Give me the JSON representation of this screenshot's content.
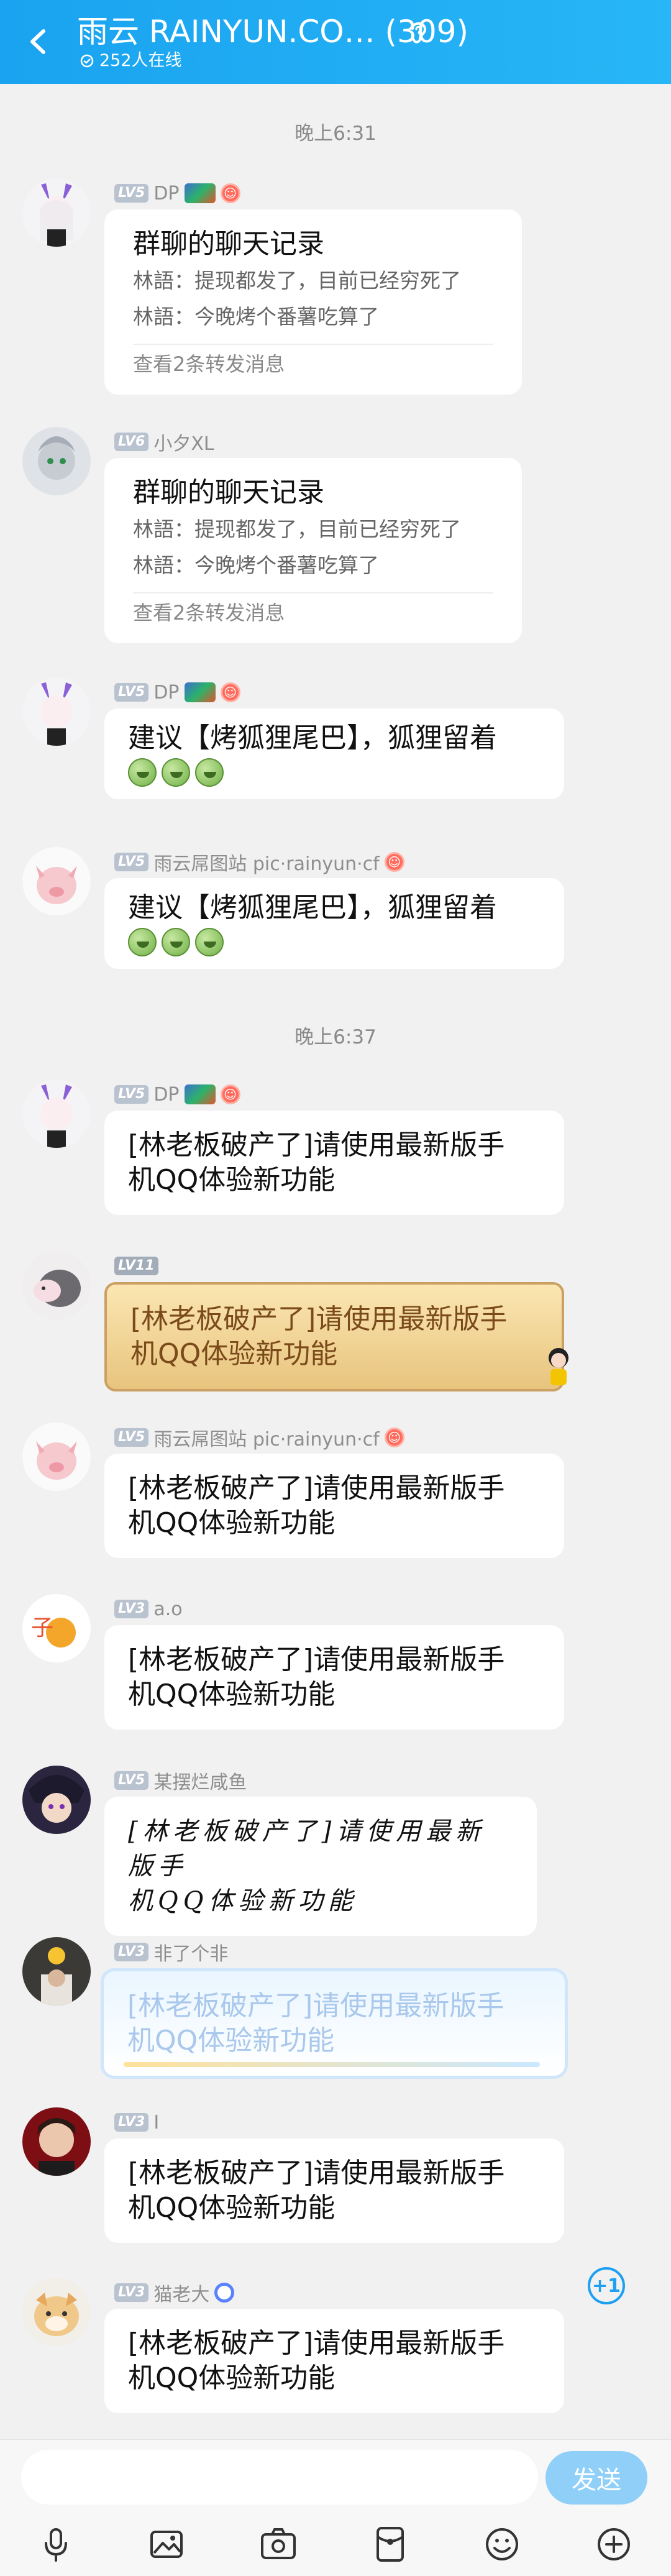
{
  "header": {
    "title": "雨云 RAINYUN.CO… (309)",
    "online": "252人在线"
  },
  "feed": {
    "time1": "晚上6:31",
    "time2": "晚上6:37",
    "messages": [
      {
        "level": "LV5",
        "name": "DP",
        "type": "forward",
        "title": "群聊的聊天记录",
        "lines": [
          "林語：提现都发了，目前已经穷死了",
          "林語：今晚烤个番薯吃算了"
        ],
        "more": "查看2条转发消息"
      },
      {
        "level": "LV6",
        "name": "小夕XL",
        "type": "forward",
        "title": "群聊的聊天记录",
        "lines": [
          "林語：提现都发了，目前已经穷死了",
          "林語：今晚烤个番薯吃算了"
        ],
        "more": "查看2条转发消息"
      },
      {
        "level": "LV5",
        "name": "DP",
        "type": "text",
        "text": "建议【烤狐狸尾巴】，狐狸留着"
      },
      {
        "level": "LV5",
        "name": "雨云屌图站 pic·rainyun·cf",
        "type": "text",
        "text": "建议【烤狐狸尾巴】，狐狸留着"
      },
      {
        "level": "LV5",
        "name": "DP",
        "text1": "[林老板破产了]请使用最新版手",
        "text2": "机QQ体验新功能"
      },
      {
        "level": "LV11",
        "name": "",
        "text1": "[林老板破产了]请使用最新版手",
        "text2": "机QQ体验新功能"
      },
      {
        "level": "LV5",
        "name": "雨云屌图站 pic·rainyun·cf",
        "text1": "[林老板破产了]请使用最新版手",
        "text2": "机QQ体验新功能"
      },
      {
        "level": "LV3",
        "name": "a.o",
        "text1": "[林老板破产了]请使用最新版手",
        "text2": "机QQ体验新功能"
      },
      {
        "level": "LV5",
        "name": "某摆烂咸鱼",
        "text1": "[林老板破产了]请使用最新版手",
        "text2": "机QQ体验新功能"
      },
      {
        "level": "LV3",
        "name": "非了个非",
        "text1": "[林老板破产了]请使用最新版手",
        "text2": "机QQ体验新功能"
      },
      {
        "level": "LV3",
        "name": "I",
        "text1": "[林老板破产了]请使用最新版手",
        "text2": "机QQ体验新功能"
      },
      {
        "level": "LV3",
        "name": "猫老大",
        "text1": "[林老板破产了]请使用最新版手",
        "text2": "机QQ体验新功能"
      }
    ],
    "plus_one": "+1"
  },
  "input": {
    "placeholder": "",
    "send_label": "发送"
  },
  "tools": [
    "microphone-icon",
    "image-icon",
    "camera-icon",
    "red-packet-icon",
    "emoji-icon",
    "plus-icon"
  ],
  "colors": {
    "header": "#1aa3f0",
    "send": "#8fcff8",
    "accent": "#1da0f2"
  }
}
